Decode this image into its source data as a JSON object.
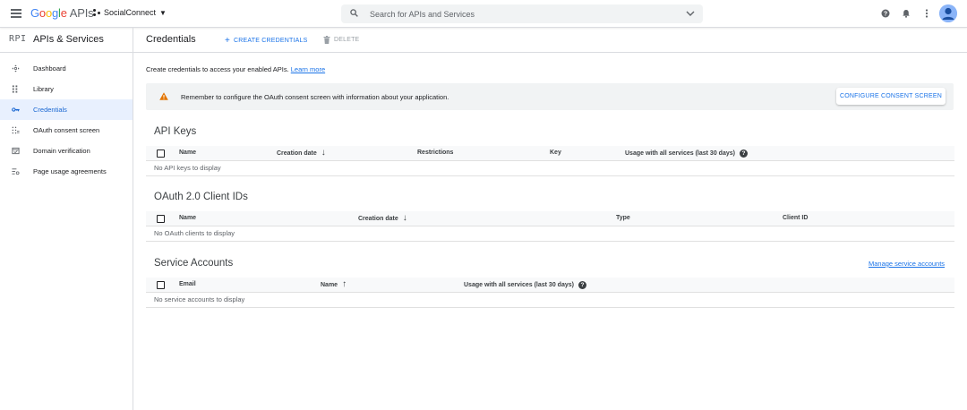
{
  "topbar": {
    "logo_google": "Google",
    "logo_apis": "APIs",
    "project_name": "SocialConnect",
    "search_placeholder": "Search for APIs and Services",
    "icons": [
      "menu-icon",
      "project-icon",
      "search-icon",
      "chevron-down-icon",
      "help-icon",
      "notifications-icon",
      "more-vert-icon",
      "avatar"
    ]
  },
  "sidebar": {
    "header_icon": "RPI",
    "header_title": "APIs & Services",
    "items": [
      {
        "label": "Dashboard",
        "icon": "dashboard-icon",
        "active": false
      },
      {
        "label": "Library",
        "icon": "library-icon",
        "active": false
      },
      {
        "label": "Credentials",
        "icon": "key-icon",
        "active": true
      },
      {
        "label": "OAuth consent screen",
        "icon": "consent-icon",
        "active": false
      },
      {
        "label": "Domain verification",
        "icon": "domain-icon",
        "active": false
      },
      {
        "label": "Page usage agreements",
        "icon": "settings-list-icon",
        "active": false
      }
    ]
  },
  "main": {
    "title": "Credentials",
    "create_label": "CREATE CREDENTIALS",
    "delete_label": "DELETE",
    "intro_text": "Create credentials to access your enabled APIs.",
    "intro_link": "Learn more",
    "banner": {
      "message": "Remember to configure the OAuth consent screen with information about your application.",
      "button": "CONFIGURE CONSENT SCREEN"
    },
    "api_keys": {
      "title": "API Keys",
      "columns": [
        "Name",
        "Creation date",
        "Restrictions",
        "Key",
        "Usage with all services (last 30 days)"
      ],
      "empty": "No API keys to display"
    },
    "oauth": {
      "title": "OAuth 2.0 Client IDs",
      "columns": [
        "Name",
        "Creation date",
        "Type",
        "Client ID"
      ],
      "empty": "No OAuth clients to display"
    },
    "service_accounts": {
      "title": "Service Accounts",
      "manage_link": "Manage service accounts",
      "columns": [
        "Email",
        "Name",
        "Usage with all services (last 30 days)"
      ],
      "empty": "No service accounts to display"
    }
  },
  "colors": {
    "accent": "#1a73e8",
    "active_bg": "#e8f0fe",
    "warning": "#e37400",
    "banner_bg": "#f1f3f4"
  }
}
